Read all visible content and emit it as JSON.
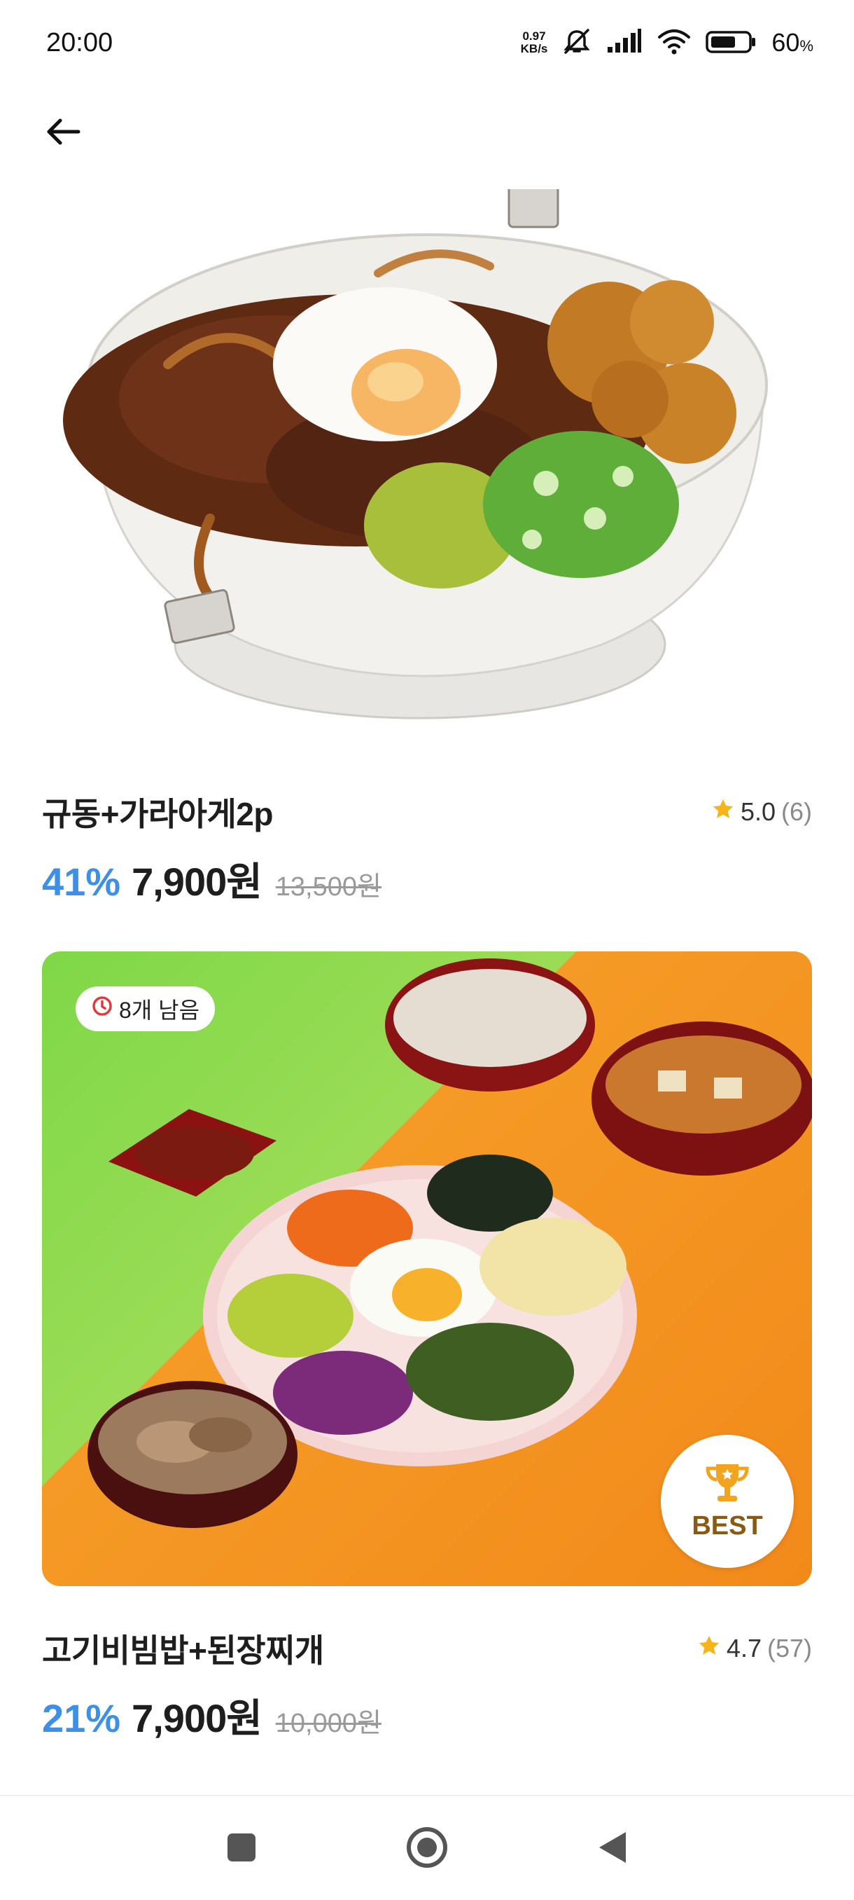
{
  "status_bar": {
    "time": "20:00",
    "net_speed_value": "0.97",
    "net_speed_unit": "KB/s",
    "battery_percent": "60",
    "battery_unit": "%",
    "icons": [
      "mute-icon",
      "signal-icon",
      "wifi-icon",
      "battery-icon"
    ]
  },
  "header": {
    "back_icon": "arrow-left-icon"
  },
  "products": [
    {
      "title": "규동+가라아게2p",
      "rating": "5.0",
      "review_count": "(6)",
      "discount": "41%",
      "price": "7,900원",
      "original_price": "13,500원"
    },
    {
      "title": "고기비빔밥+된장찌개",
      "rating": "4.7",
      "review_count": "(57)",
      "discount": "21%",
      "price": "7,900원",
      "original_price": "10,000원",
      "stock_badge": "8개 남음",
      "best_badge": "BEST"
    }
  ],
  "colors": {
    "discount": "#3e8fe6",
    "star": "#f5b418",
    "badge_clock": "#e03a3a",
    "best_text": "#8a5a12"
  },
  "nav_bar": {
    "icons": [
      "recent-apps-icon",
      "home-icon",
      "back-icon"
    ]
  }
}
